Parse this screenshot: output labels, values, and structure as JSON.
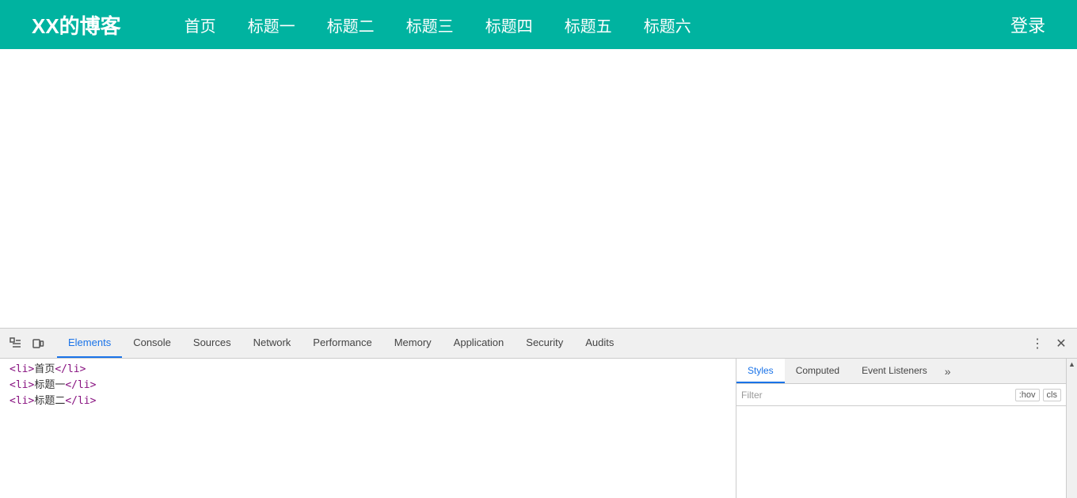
{
  "navbar": {
    "brand": "XX的博客",
    "links": [
      {
        "label": "首页"
      },
      {
        "label": "标题一"
      },
      {
        "label": "标题二"
      },
      {
        "label": "标题三"
      },
      {
        "label": "标题四"
      },
      {
        "label": "标题五"
      },
      {
        "label": "标题六"
      }
    ],
    "login": "登录"
  },
  "devtools": {
    "tabs": [
      {
        "label": "Elements",
        "active": true
      },
      {
        "label": "Console",
        "active": false
      },
      {
        "label": "Sources",
        "active": false
      },
      {
        "label": "Network",
        "active": false
      },
      {
        "label": "Performance",
        "active": false
      },
      {
        "label": "Memory",
        "active": false
      },
      {
        "label": "Application",
        "active": false
      },
      {
        "label": "Security",
        "active": false
      },
      {
        "label": "Audits",
        "active": false
      }
    ],
    "dom_lines": [
      {
        "content": "<li>首页</li>"
      },
      {
        "content": "<li>标题一</li>"
      },
      {
        "content": "<li>标题二</li>"
      }
    ],
    "style_tabs": [
      {
        "label": "Styles",
        "active": true
      },
      {
        "label": "Computed",
        "active": false
      },
      {
        "label": "Event Listeners",
        "active": false
      }
    ],
    "filter_placeholder": "Filter",
    "filter_options": [
      ":hov",
      "cls"
    ]
  }
}
